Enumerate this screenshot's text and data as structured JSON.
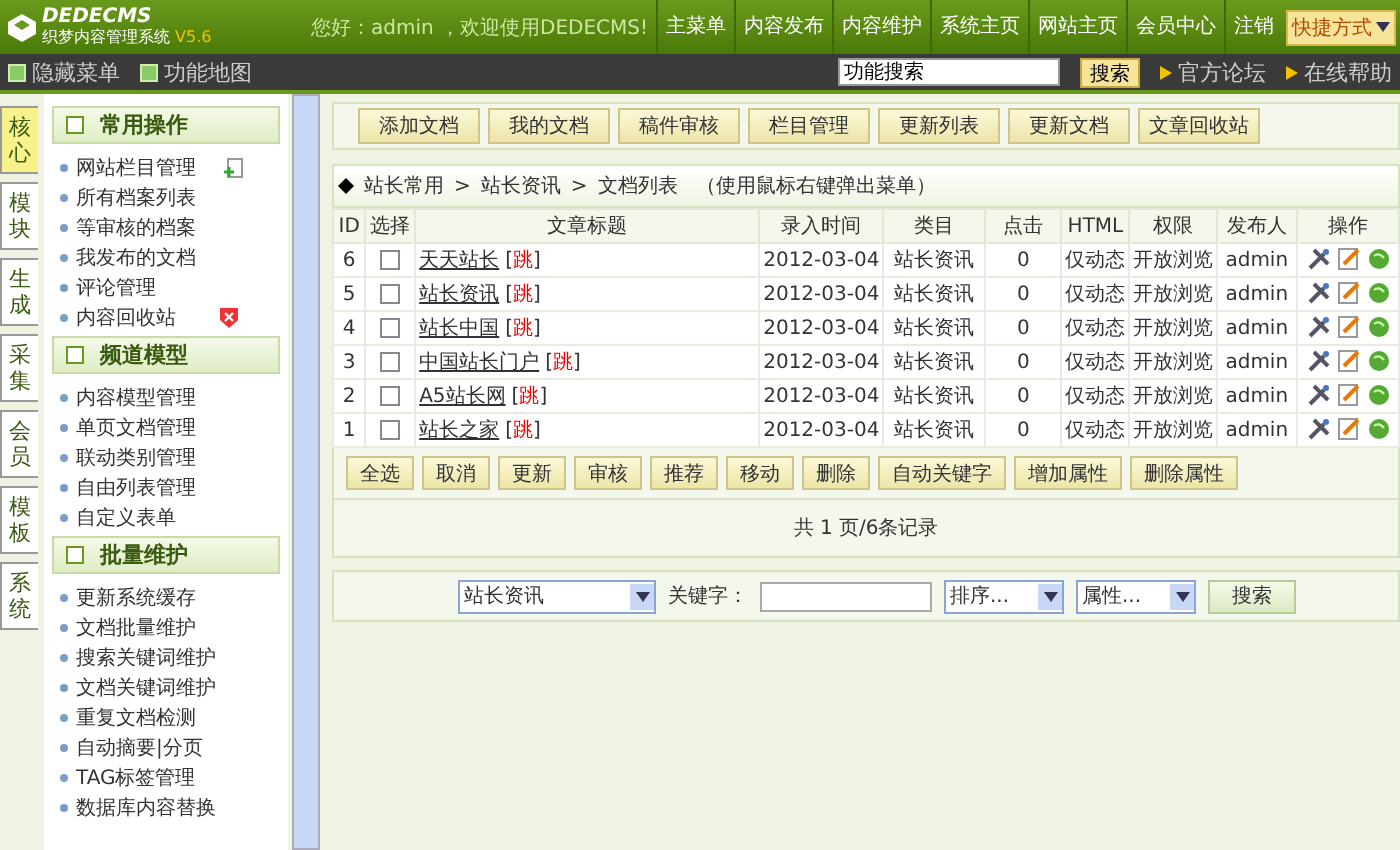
{
  "header": {
    "logo": "DEDECMS",
    "subtitle": "织梦内容管理系统",
    "version": "V5.6",
    "welcome": "您好：admin ，欢迎使用DEDECMS!",
    "nav": [
      "主菜单",
      "内容发布",
      "内容维护",
      "系统主页",
      "网站主页",
      "会员中心",
      "注销"
    ],
    "shortcut": "快捷方式"
  },
  "toolbar": {
    "links": [
      "隐藏菜单",
      "功能地图"
    ],
    "search_value": "功能搜索",
    "search_button": "搜索",
    "help_links": [
      "官方论坛",
      "在线帮助"
    ]
  },
  "side_tabs": [
    {
      "label": "核心",
      "selected": true
    },
    {
      "label": "模块",
      "selected": false
    },
    {
      "label": "生成",
      "selected": false
    },
    {
      "label": "采集",
      "selected": false
    },
    {
      "label": "会员",
      "selected": false
    },
    {
      "label": "模板",
      "selected": false
    },
    {
      "label": "系统",
      "selected": false
    }
  ],
  "menu_groups": [
    {
      "title": "常用操作",
      "items": [
        {
          "label": "网站栏目管理",
          "kind": "add"
        },
        {
          "label": "所有档案列表",
          "kind": "plain"
        },
        {
          "label": "等审核的档案",
          "kind": "plain"
        },
        {
          "label": "我发布的文档",
          "kind": "plain"
        },
        {
          "label": "评论管理",
          "kind": "plain"
        },
        {
          "label": "内容回收站",
          "kind": "trash"
        }
      ]
    },
    {
      "title": "频道模型",
      "items": [
        {
          "label": "内容模型管理",
          "kind": "plain"
        },
        {
          "label": "单页文档管理",
          "kind": "plain"
        },
        {
          "label": "联动类别管理",
          "kind": "plain"
        },
        {
          "label": "自由列表管理",
          "kind": "plain"
        },
        {
          "label": "自定义表单",
          "kind": "plain"
        }
      ]
    },
    {
      "title": "批量维护",
      "items": [
        {
          "label": "更新系统缓存",
          "kind": "plain"
        },
        {
          "label": "文档批量维护",
          "kind": "plain"
        },
        {
          "label": "搜索关键词维护",
          "kind": "plain"
        },
        {
          "label": "文档关键词维护",
          "kind": "plain"
        },
        {
          "label": "重复文档检测",
          "kind": "plain"
        },
        {
          "label": "自动摘要|分页",
          "kind": "plain"
        },
        {
          "label": "TAG标签管理",
          "kind": "plain"
        },
        {
          "label": "数据库内容替换",
          "kind": "plain"
        }
      ]
    }
  ],
  "action_buttons": [
    "添加文档",
    "我的文档",
    "稿件审核",
    "栏目管理",
    "更新列表",
    "更新文档",
    "文章回收站"
  ],
  "breadcrumb": {
    "path": [
      "站长常用",
      "站长资讯",
      "文档列表"
    ],
    "separator": ">",
    "hint": "（使用鼠标右键弹出菜单）"
  },
  "table": {
    "columns": [
      "ID",
      "选择",
      "文章标题",
      "录入时间",
      "类目",
      "点击",
      "HTML",
      "权限",
      "发布人",
      "操作"
    ],
    "rows": [
      {
        "id": "6",
        "checked": false,
        "title": "天天站长",
        "jump": "[跳]",
        "date": "2012-03-04",
        "category": "站长资讯",
        "clicks": "0",
        "html": "仅动态",
        "permission": "开放浏览",
        "author": "admin"
      },
      {
        "id": "5",
        "checked": false,
        "title": "站长资讯",
        "jump": "[跳]",
        "date": "2012-03-04",
        "category": "站长资讯",
        "clicks": "0",
        "html": "仅动态",
        "permission": "开放浏览",
        "author": "admin"
      },
      {
        "id": "4",
        "checked": false,
        "title": "站长中国",
        "jump": "[跳]",
        "date": "2012-03-04",
        "category": "站长资讯",
        "clicks": "0",
        "html": "仅动态",
        "permission": "开放浏览",
        "author": "admin"
      },
      {
        "id": "3",
        "checked": false,
        "title": "中国站长门户",
        "jump": "[跳]",
        "date": "2012-03-04",
        "category": "站长资讯",
        "clicks": "0",
        "html": "仅动态",
        "permission": "开放浏览",
        "author": "admin"
      },
      {
        "id": "2",
        "checked": false,
        "title": "A5站长网",
        "jump": "[跳]",
        "date": "2012-03-04",
        "category": "站长资讯",
        "clicks": "0",
        "html": "仅动态",
        "permission": "开放浏览",
        "author": "admin"
      },
      {
        "id": "1",
        "checked": false,
        "title": "站长之家",
        "jump": "[跳]",
        "date": "2012-03-04",
        "category": "站长资讯",
        "clicks": "0",
        "html": "仅动态",
        "permission": "开放浏览",
        "author": "admin"
      }
    ]
  },
  "batch_buttons": [
    "全选",
    "取消",
    "更新",
    "审核",
    "推荐",
    "移动",
    "删除",
    "自动关键字",
    "增加属性",
    "删除属性"
  ],
  "pagination": "共 1 页/6条记录",
  "filter": {
    "category": "站长资讯",
    "keyword_label": "关键字：",
    "sort": "排序...",
    "attribute": "属性...",
    "search_button": "搜索"
  }
}
